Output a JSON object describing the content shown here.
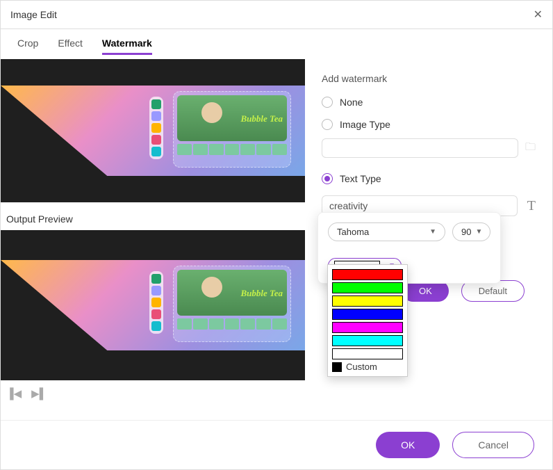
{
  "title": "Image Edit",
  "tabs": {
    "crop": "Crop",
    "effect": "Effect",
    "watermark": "Watermark"
  },
  "output_label": "Output Preview",
  "watermark_preview_text": "creativity",
  "thumb_label": "Bubble Tea",
  "panel": {
    "section": "Add watermark",
    "none": "None",
    "image": "Image Type",
    "text": "Text Type",
    "text_value": "creativity",
    "font": "Tahoma",
    "size": "90",
    "ok": "OK",
    "default": "Default"
  },
  "colors": {
    "red": "#ff0000",
    "green": "#00ff00",
    "yellow": "#ffff00",
    "blue": "#0000ff",
    "magenta": "#ff00ff",
    "cyan": "#00ffff",
    "white": "#ffffff",
    "custom": "Custom"
  },
  "footer": {
    "ok": "OK",
    "cancel": "Cancel"
  }
}
